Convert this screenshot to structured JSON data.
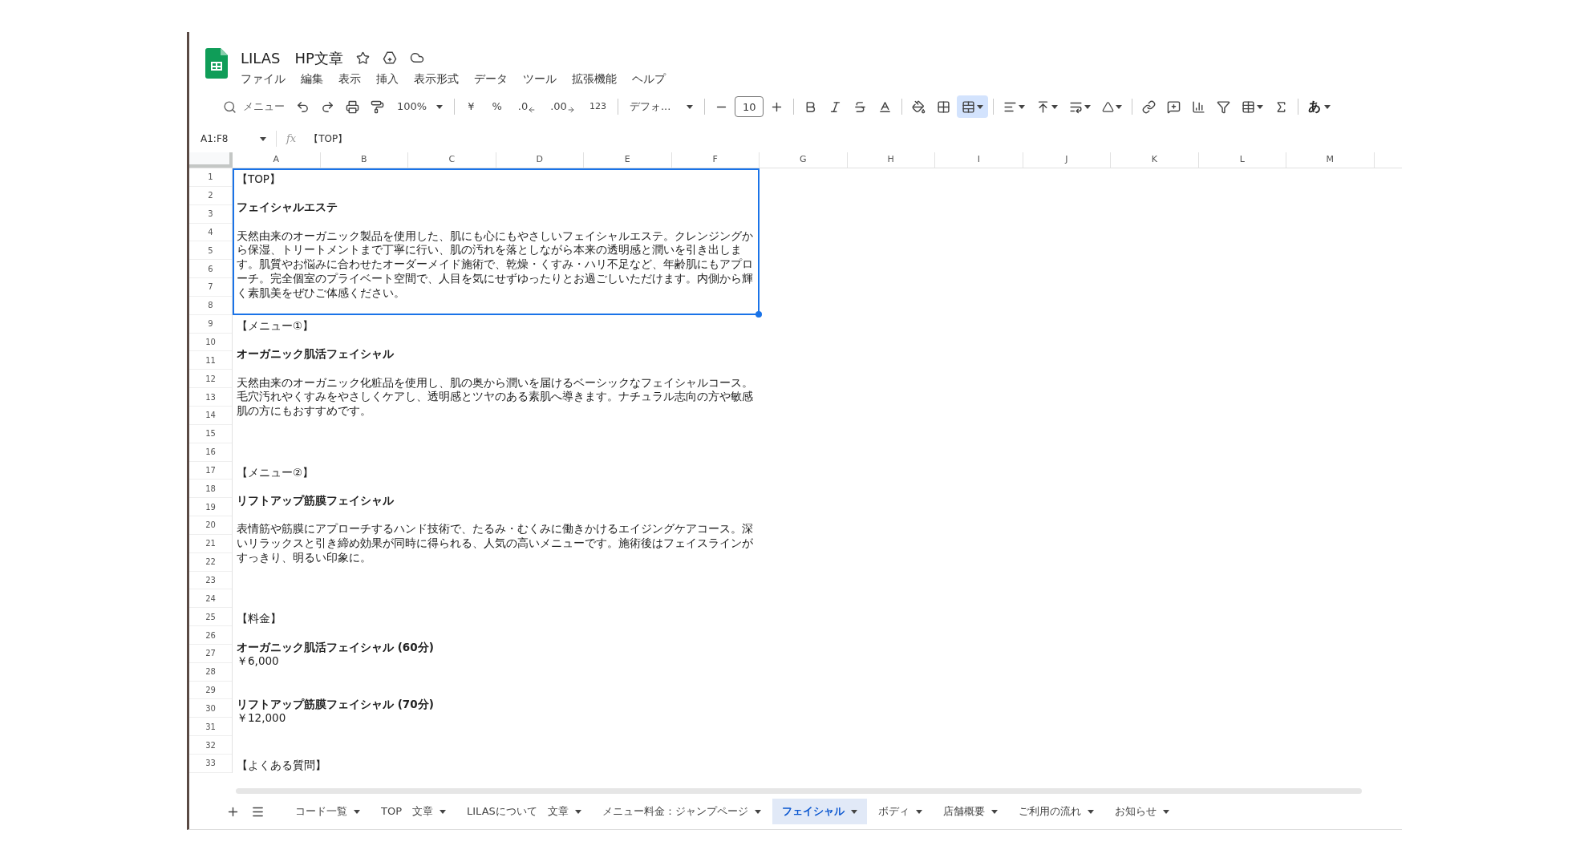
{
  "document": {
    "title": "LILAS　HP文章"
  },
  "menu": [
    "ファイル",
    "編集",
    "表示",
    "挿入",
    "表示形式",
    "データ",
    "ツール",
    "拡張機能",
    "ヘルプ"
  ],
  "toolbar": {
    "search_label": "メニュー",
    "zoom": "100%",
    "currency": "¥",
    "percent": "%",
    "decrease_decimal": ".0",
    "increase_decimal": ".00",
    "number_format": "123",
    "font": "デフォ...",
    "font_size": "10",
    "merge_cells_on": true,
    "input_tool": "あ"
  },
  "formula_bar": {
    "name_box": "A1:F8",
    "fx_label": "fx",
    "value": "【TOP】"
  },
  "columns": [
    "A",
    "B",
    "C",
    "D",
    "E",
    "F",
    "G",
    "H",
    "I",
    "J",
    "K",
    "L",
    "M"
  ],
  "row_numbers": [
    "1",
    "2",
    "3",
    "4",
    "5",
    "6",
    "7",
    "8",
    "9",
    "10",
    "11",
    "12",
    "13",
    "14",
    "15",
    "16",
    "17",
    "18",
    "19",
    "20",
    "21",
    "22",
    "23",
    "24",
    "25",
    "26",
    "27",
    "28",
    "29",
    "30",
    "31",
    "32",
    "33"
  ],
  "cells": [
    {
      "kind": "section",
      "selected": true,
      "lines": [
        {
          "kind": "label",
          "text": "【TOP】"
        },
        {
          "kind": "title",
          "text": "フェイシャルエステ"
        },
        {
          "kind": "body",
          "text": "天然由来のオーガニック製品を使用した、肌にも心にもやさしいフェイシャルエステ。クレンジングから保湿、トリートメントまで丁寧に行い、肌の汚れを落としながら本来の透明感と潤いを引き出します。肌質やお悩みに合わせたオーダーメイド施術で、乾燥・くすみ・ハリ不足など、年齢肌にもアプローチ。完全個室のプライベート空間で、人目を気にせずゆったりとお過ごしいただけます。内側から輝く素肌美をぜひご体感ください。"
        }
      ]
    },
    {
      "kind": "section",
      "selected": false,
      "lines": [
        {
          "kind": "label",
          "text": "【メニュー①】"
        },
        {
          "kind": "title",
          "text": "オーガニック肌活フェイシャル"
        },
        {
          "kind": "body",
          "text": "天然由来のオーガニック化粧品を使用し、肌の奥から潤いを届けるベーシックなフェイシャルコース。毛穴汚れやくすみをやさしくケアし、透明感とツヤのある素肌へ導きます。ナチュラル志向の方や敏感肌の方にもおすすめです。"
        }
      ]
    },
    {
      "kind": "section",
      "selected": false,
      "lines": [
        {
          "kind": "label",
          "text": "【メニュー②】"
        },
        {
          "kind": "title",
          "text": "リフトアップ筋膜フェイシャル"
        },
        {
          "kind": "body",
          "text": "表情筋や筋膜にアプローチするハンド技術で、たるみ・むくみに働きかけるエイジングケアコース。深いリラックスと引き締め効果が同時に得られる、人気の高いメニューです。施術後はフェイスラインがすっきり、明るい印象に。"
        }
      ]
    },
    {
      "kind": "section",
      "selected": false,
      "lines": [
        {
          "kind": "label",
          "text": "【料金】"
        },
        {
          "kind": "title",
          "text": "オーガニック肌活フェイシャル (60分)"
        },
        {
          "kind": "price",
          "text": "￥6,000"
        },
        {
          "kind": "title",
          "text": "リフトアップ筋膜フェイシャル (70分)"
        },
        {
          "kind": "price",
          "text": "￥12,000"
        }
      ]
    },
    {
      "kind": "single",
      "selected": false,
      "lines": [
        {
          "kind": "label",
          "text": "【よくある質問】"
        }
      ]
    }
  ],
  "sheet_tabs": [
    {
      "label": "コード一覧",
      "selected": false
    },
    {
      "label": "TOP　文章",
      "selected": false
    },
    {
      "label": "LILASについて　文章",
      "selected": false
    },
    {
      "label": "メニュー料金：ジャンプページ",
      "selected": false
    },
    {
      "label": "フェイシャル",
      "selected": true
    },
    {
      "label": "ボディ",
      "selected": false
    },
    {
      "label": "店舗概要",
      "selected": false
    },
    {
      "label": "ご利用の流れ",
      "selected": false
    },
    {
      "label": "お知らせ",
      "selected": false
    }
  ]
}
